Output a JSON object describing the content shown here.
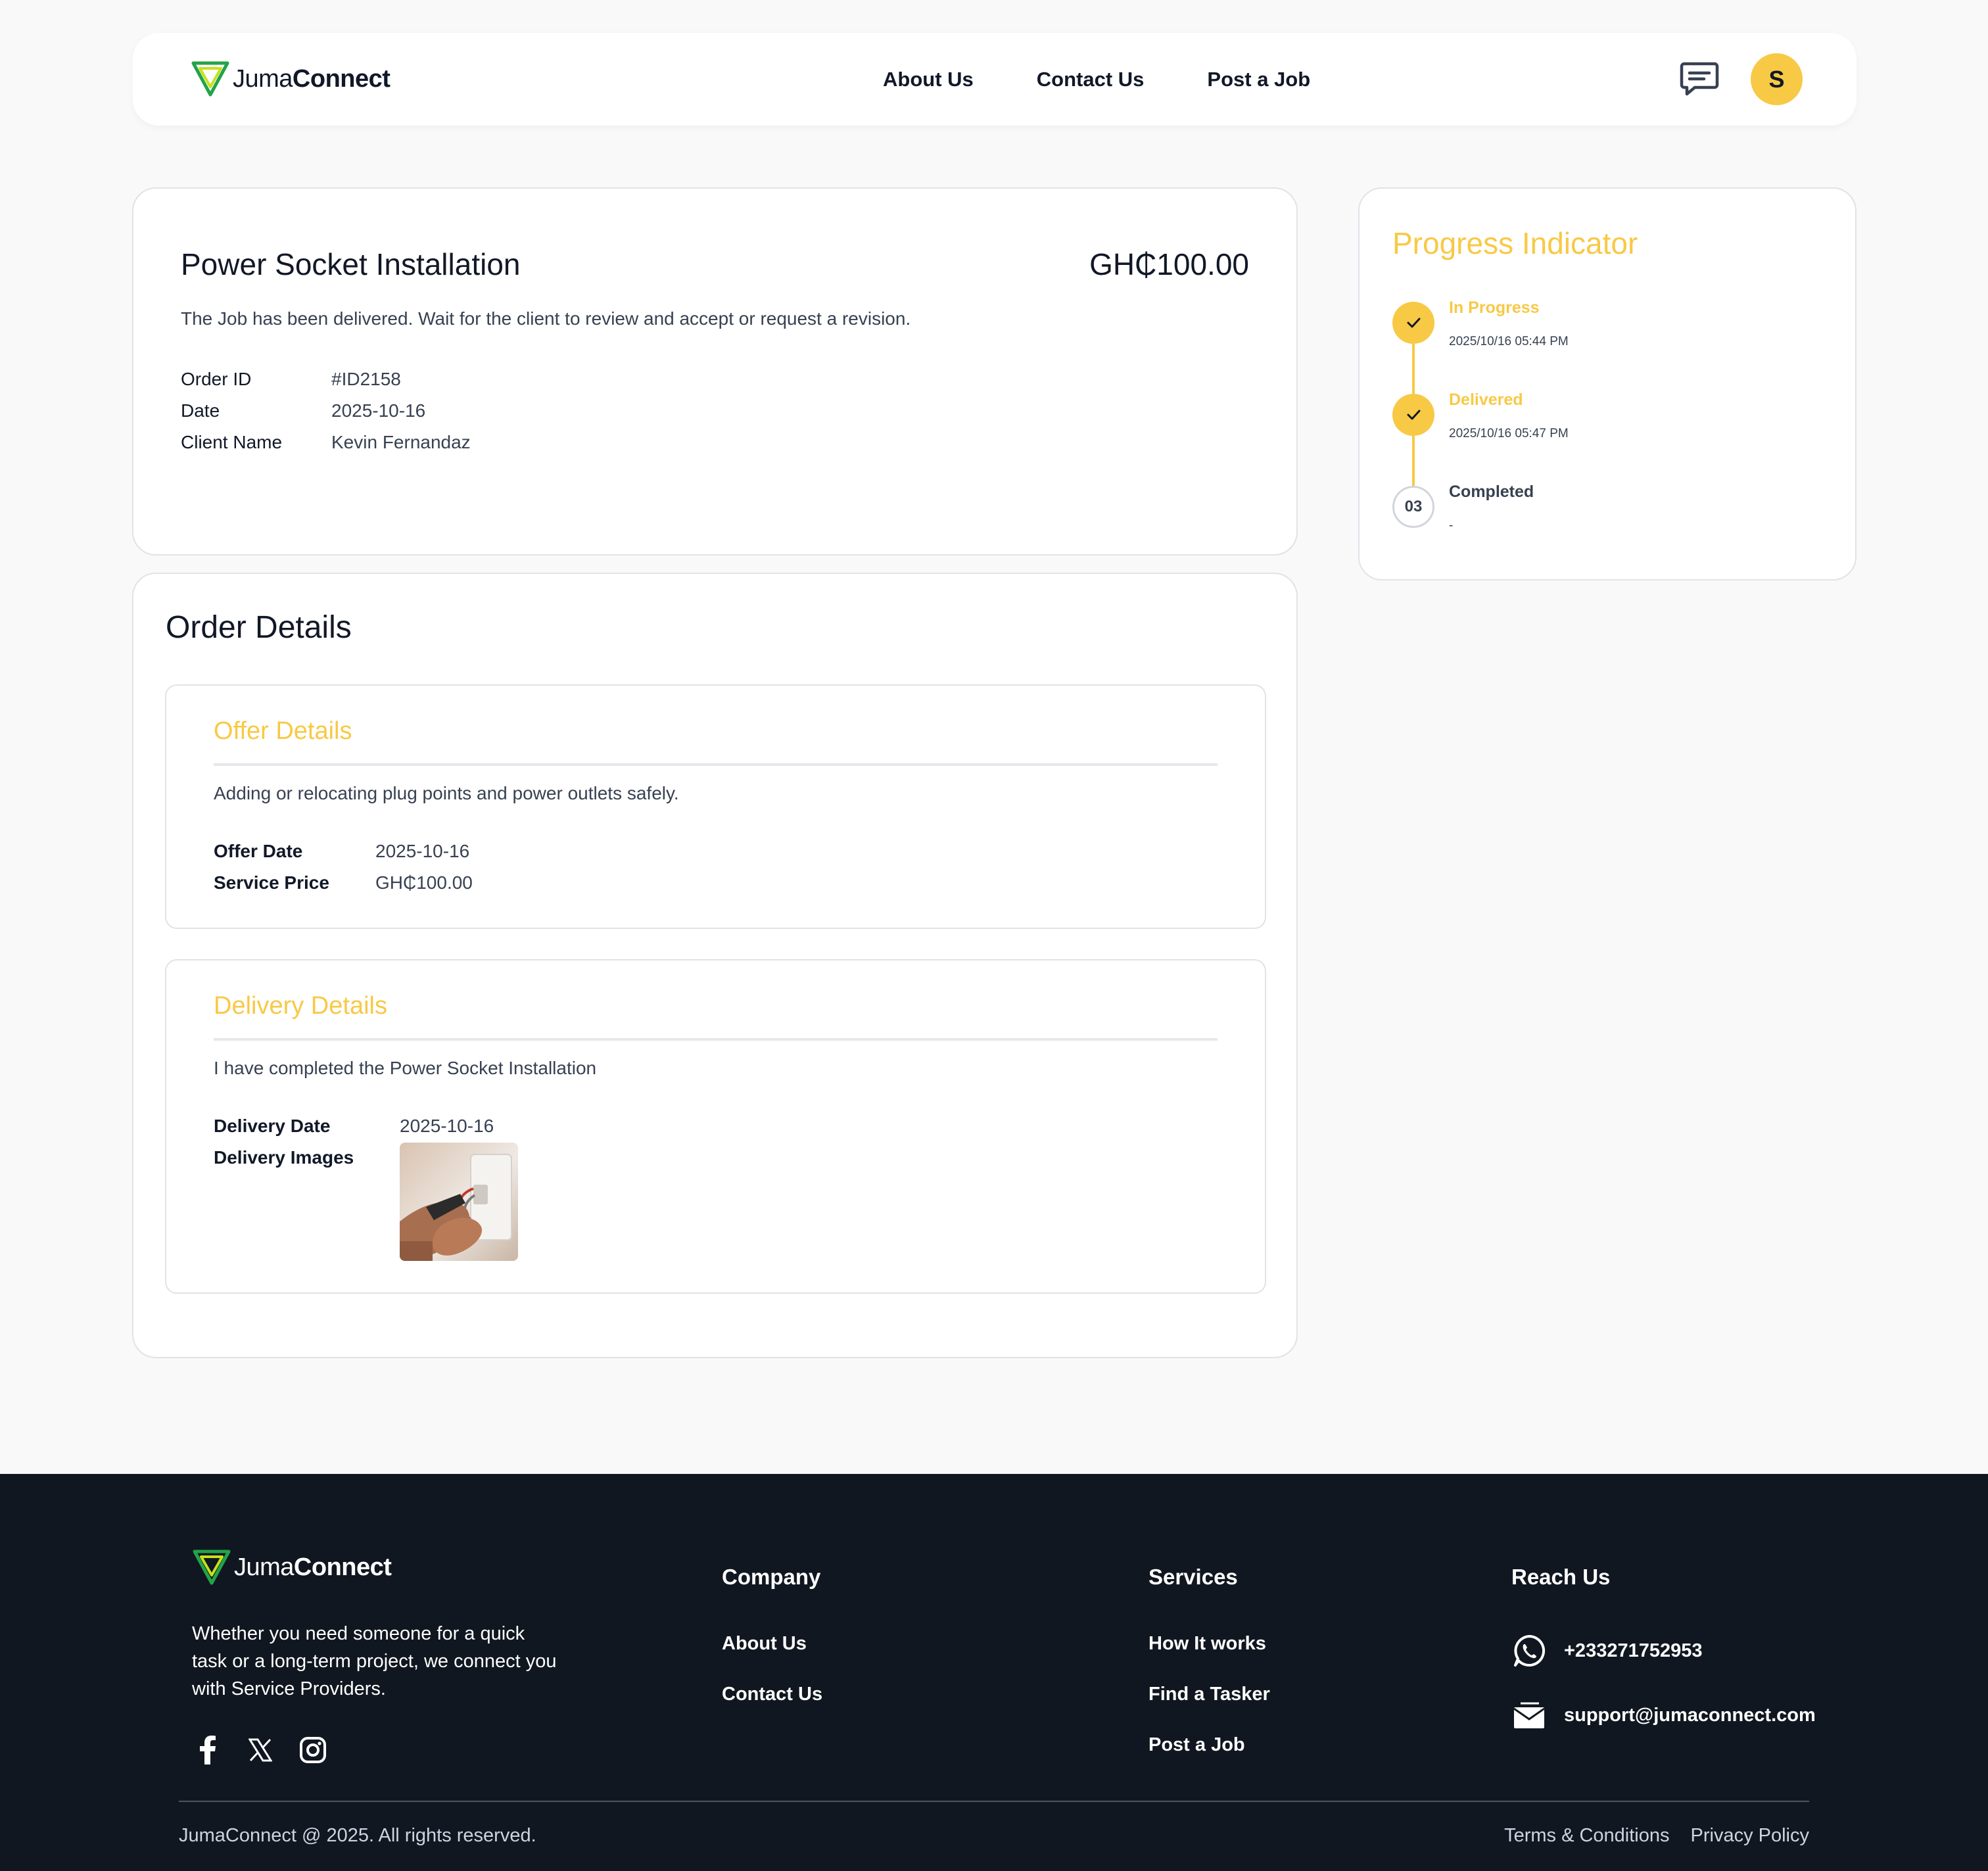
{
  "brand": {
    "name_light": "Juma",
    "name_bold": "Connect",
    "accent_color": "#f8c945",
    "logo_green": "#22a34a",
    "logo_lime": "#c5e21b"
  },
  "header": {
    "nav": [
      "About Us",
      "Contact Us",
      "Post a Job"
    ],
    "chat_icon": "chat-bubble-icon",
    "avatar_initial": "S"
  },
  "job": {
    "title": "Power Socket Installation",
    "price": "GH₵100.00",
    "message": "The Job has been delivered. Wait for the client to review and accept or request a revision.",
    "meta": [
      {
        "label": "Order ID",
        "value": "#ID2158"
      },
      {
        "label": "Date",
        "value": "2025-10-16"
      },
      {
        "label": "Client Name",
        "value": "Kevin Fernandaz"
      }
    ]
  },
  "order_details": {
    "title": "Order Details",
    "offer": {
      "title": "Offer Details",
      "description": "Adding or relocating plug points and power outlets safely.",
      "meta": [
        {
          "label": "Offer Date",
          "value": "2025-10-16"
        },
        {
          "label": "Service Price",
          "value": "GH₵100.00"
        }
      ]
    },
    "delivery": {
      "title": "Delivery Details",
      "description": "I have completed the Power Socket Installation",
      "date_label": "Delivery Date",
      "date_value": "2025-10-16",
      "images_label": "Delivery Images"
    }
  },
  "progress": {
    "title": "Progress Indicator",
    "steps": [
      {
        "label": "In Progress",
        "time": "2025/10/16 05:44 PM",
        "status": "done"
      },
      {
        "label": "Delivered",
        "time": "2025/10/16 05:47 PM",
        "status": "done"
      },
      {
        "label": "Completed",
        "time": "-",
        "status": "pending",
        "number": "03"
      }
    ]
  },
  "footer": {
    "tagline": "Whether you need someone for a quick task or a long-term project, we connect you with Service Providers.",
    "socials": [
      "facebook-icon",
      "x-icon",
      "instagram-icon"
    ],
    "company": {
      "title": "Company",
      "links": [
        "About Us",
        "Contact Us"
      ]
    },
    "services": {
      "title": "Services",
      "links": [
        "How It works",
        "Find a Tasker",
        "Post a Job"
      ]
    },
    "reach": {
      "title": "Reach Us",
      "phone": "+233271752953",
      "email": "support@jumaconnect.com"
    },
    "copyright": "JumaConnect @ 2025. All rights reserved.",
    "legal": [
      "Terms & Conditions",
      "Privacy Policy"
    ]
  }
}
